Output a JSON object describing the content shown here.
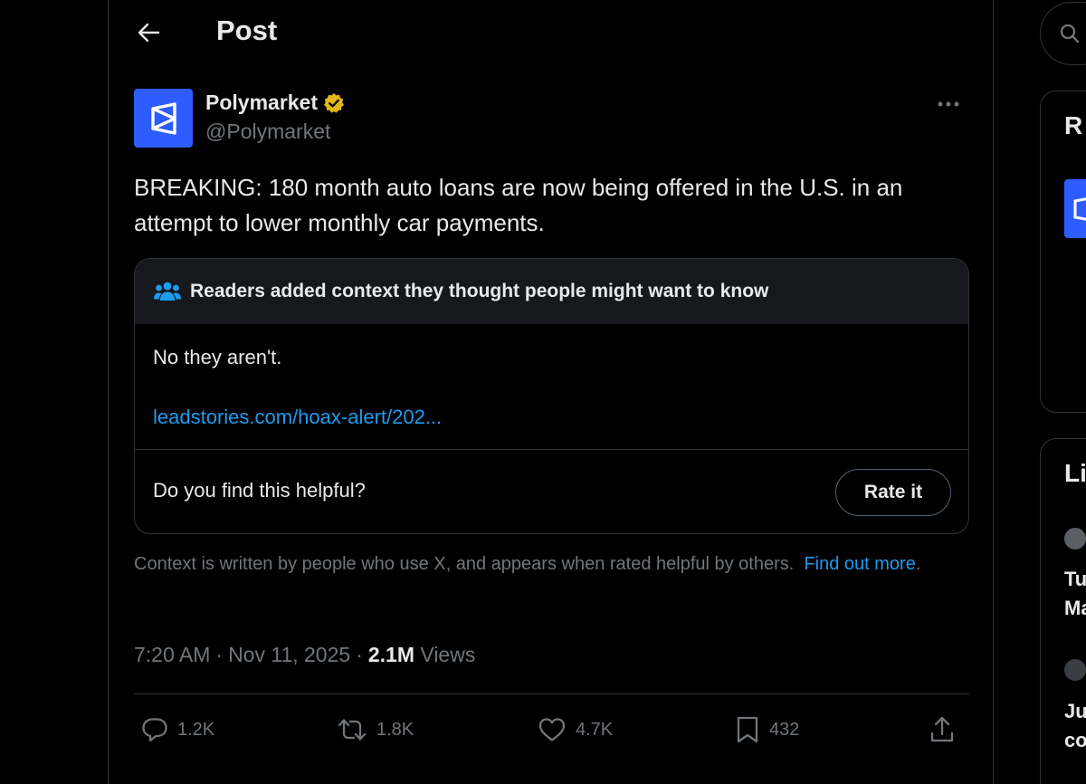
{
  "header": {
    "title": "Post"
  },
  "post": {
    "author": {
      "display_name": "Polymarket",
      "handle": "@Polymarket",
      "verified": true
    },
    "text": "BREAKING: 180 month auto loans are now being offered in the U.S. in an attempt to lower monthly car payments.",
    "community_note": {
      "heading": "Readers added context they thought people might want to know",
      "body": "No they aren't.",
      "link": "leadstories.com/hoax-alert/202...",
      "question": "Do you find this helpful?",
      "rate_label": "Rate it"
    },
    "context_note": {
      "text": "Context is written by people who use X, and appears when rated helpful by others.",
      "link_label": "Find out more"
    },
    "time": "7:20 AM",
    "date": "Nov 11, 2025",
    "separator": "·",
    "views_count": "2.1M",
    "views_label": "Views",
    "actions": {
      "replies": "1.2K",
      "reposts": "1.8K",
      "likes": "4.7K",
      "bookmarks": "432"
    }
  },
  "right_column": {
    "panel1_title": "R",
    "panel2_title": "Li",
    "item1_line1": "Tu",
    "item1_line2": "Ma",
    "item2_line1": "Ju",
    "item2_line2": "co"
  },
  "colors": {
    "background": "#000000",
    "accent": "#1d9bf0",
    "brand": "#2e5cff",
    "verified": "#e2b719",
    "border": "#2f3336",
    "muted_text": "#71767b"
  }
}
